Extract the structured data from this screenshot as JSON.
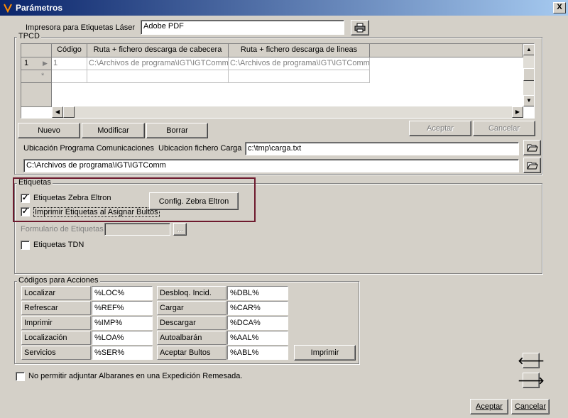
{
  "window": {
    "title": "Parámetros",
    "close_label": "X"
  },
  "printer": {
    "label": "Impresora para Etiquetas Láser",
    "value": "Adobe PDF"
  },
  "tpcd": {
    "group_label": "TPCD",
    "columns": [
      "Código",
      "Ruta + fichero descarga de cabecera",
      "Ruta + fichero descarga de lineas"
    ],
    "rows": [
      {
        "indicator": "1",
        "codigo": "1",
        "cabecera": "C:\\Archivos de programa\\IGT\\IGTComm\\",
        "lineas": "C:\\Archivos de programa\\IGT\\IGTComm\\"
      }
    ],
    "new_row_marker": "*",
    "buttons": {
      "nuevo": "Nuevo",
      "modificar": "Modificar",
      "borrar": "Borrar",
      "aceptar": "Aceptar",
      "cancelar": "Cancelar"
    },
    "ubicacion_programa_label": "Ubicación Programa Comunicaciones",
    "ubicacion_fichero_label": "Ubicacion fichero Carga",
    "ubicacion_fichero_value": "c:\\tmp\\carga.txt",
    "ubicacion_programa_value": "C:\\Archivos de programa\\IGT\\IGTComm"
  },
  "etiquetas": {
    "group_label": "Etiquetas",
    "zebra_label": "Etiquetas Zebra Eltron",
    "zebra_checked": true,
    "imprimir_label": "Imprimir Etiquetas al Asignar Bultos",
    "imprimir_checked": true,
    "config_button": "Config. Zebra Eltron",
    "formulario_label": "Formulario de Etiquetas",
    "formulario_value": "",
    "browse_label": "...",
    "tdn_label": "Etiquetas TDN",
    "tdn_checked": false
  },
  "codigos": {
    "group_label": "Códigos para Acciones",
    "left": [
      {
        "label": "Localizar",
        "value": "%LOC%"
      },
      {
        "label": "Refrescar",
        "value": "%REF%"
      },
      {
        "label": "Imprimir",
        "value": "%IMP%"
      },
      {
        "label": "Localización",
        "value": "%LOA%"
      },
      {
        "label": "Servicios",
        "value": "%SER%"
      }
    ],
    "right": [
      {
        "label": "Desbloq. Incid.",
        "value": "%DBL%"
      },
      {
        "label": "Cargar",
        "value": "%CAR%"
      },
      {
        "label": "Descargar",
        "value": "%DCA%"
      },
      {
        "label": "Autoalbarán",
        "value": "%AAL%"
      },
      {
        "label": "Aceptar Bultos",
        "value": "%ABL%"
      }
    ],
    "imprimir_button": "Imprimir"
  },
  "no_permitir": {
    "label": "No permitir adjuntar Albaranes en una Expedición Remesada.",
    "checked": false
  },
  "footer": {
    "aceptar": "Aceptar",
    "cancelar": "Cancelar"
  },
  "icons": {
    "printer": "printer-icon",
    "folder": "folder-open-icon",
    "prev": "arrow-left-icon",
    "next": "arrow-right-icon"
  },
  "colors": {
    "title_start": "#0a246a",
    "title_end": "#a6caf0",
    "highlight": "#6e1a2e"
  }
}
